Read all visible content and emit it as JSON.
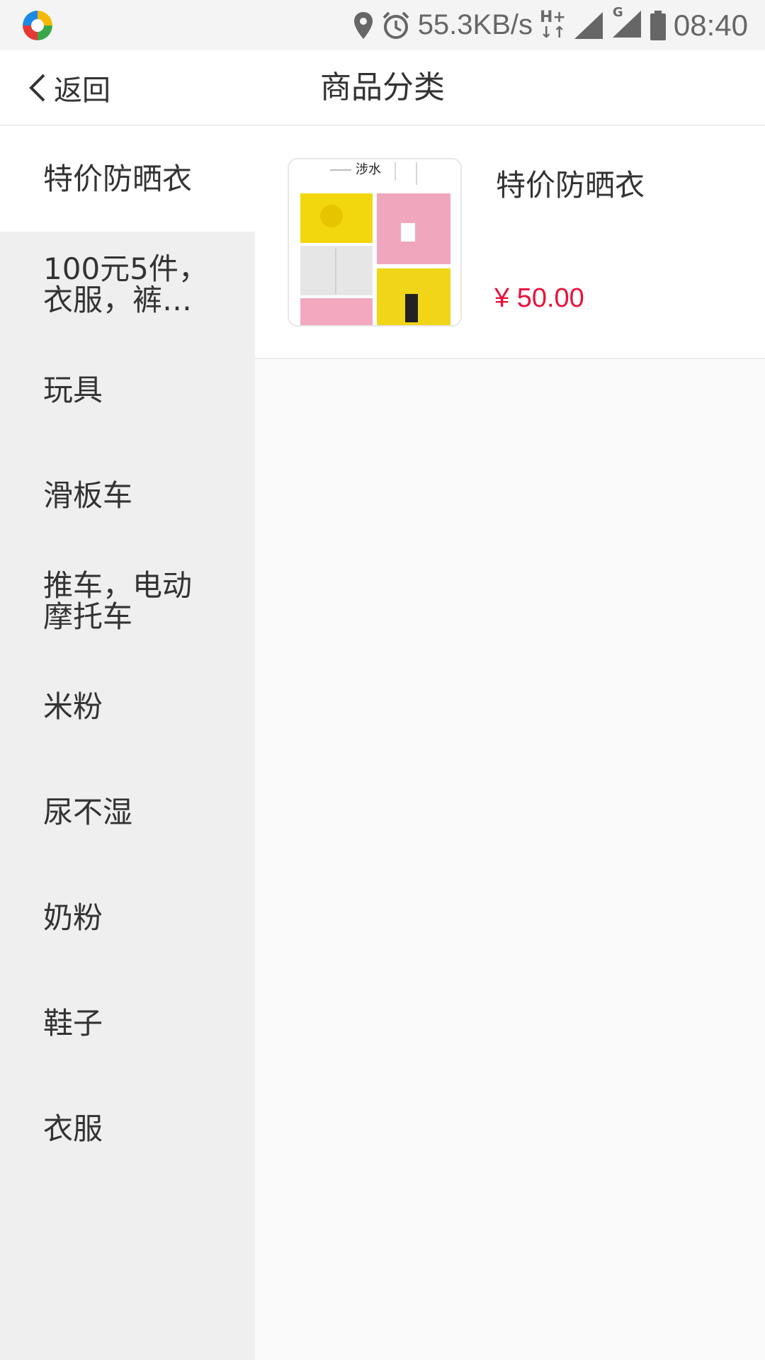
{
  "status_bar": {
    "speed": "55.3KB/s",
    "net_type_top": "H+",
    "net_type_g": "G",
    "time": "08:40",
    "icons": [
      "location-icon",
      "alarm-icon",
      "data-arrows-icon",
      "signal-icon",
      "signal-g-icon",
      "battery-icon"
    ]
  },
  "header": {
    "back_label": "返回",
    "title": "商品分类"
  },
  "sidebar": {
    "items": [
      {
        "label": "特价防晒衣",
        "active": true
      },
      {
        "label": "100元5件，衣服，裤子..."
      },
      {
        "label": "玩具"
      },
      {
        "label": "滑板车"
      },
      {
        "label": "推车，电动摩托车"
      },
      {
        "label": "米粉"
      },
      {
        "label": "尿不湿"
      },
      {
        "label": "奶粉"
      },
      {
        "label": "鞋子"
      },
      {
        "label": "衣服"
      }
    ]
  },
  "product": {
    "name": "特价防晒衣",
    "price": "¥ 50.00",
    "thumb_caption": "涉水"
  },
  "colors": {
    "price": "#e8113b",
    "sidebar_bg": "#efefef",
    "content_bg": "#f9f9f9"
  }
}
